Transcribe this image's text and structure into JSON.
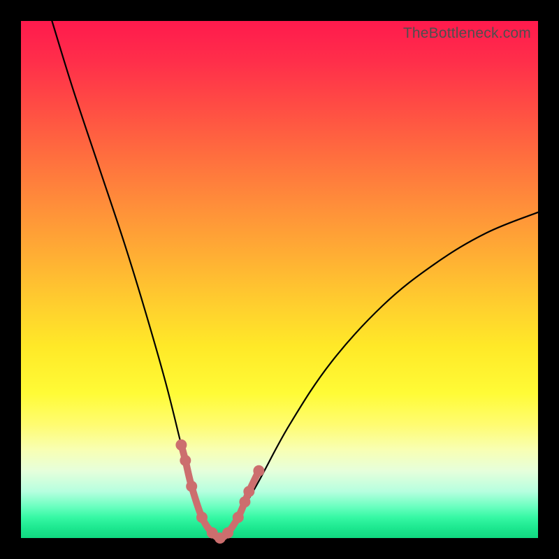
{
  "watermark": "TheBottleneck.com",
  "chart_data": {
    "type": "line",
    "title": "",
    "xlabel": "",
    "ylabel": "",
    "xlim": [
      0,
      100
    ],
    "ylim": [
      0,
      100
    ],
    "grid": false,
    "legend": false,
    "background": "rainbow-gradient",
    "series": [
      {
        "name": "bottleneck-curve",
        "x": [
          6,
          10,
          15,
          20,
          24,
          28,
          31,
          33,
          35,
          37,
          38.5,
          40,
          42,
          46,
          52,
          60,
          70,
          80,
          90,
          100
        ],
        "values": [
          100,
          87,
          72,
          57,
          44,
          30,
          18,
          10,
          4,
          1,
          0,
          1,
          4,
          11,
          22,
          34,
          45,
          53,
          59,
          63
        ]
      }
    ],
    "markers": {
      "name": "highlighted-range",
      "color": "#cc6e6e",
      "points": [
        {
          "x": 31,
          "y": 18
        },
        {
          "x": 31.8,
          "y": 15
        },
        {
          "x": 33,
          "y": 10
        },
        {
          "x": 35,
          "y": 4
        },
        {
          "x": 37,
          "y": 1
        },
        {
          "x": 38.5,
          "y": 0
        },
        {
          "x": 40,
          "y": 1
        },
        {
          "x": 42,
          "y": 4
        },
        {
          "x": 43.3,
          "y": 7
        },
        {
          "x": 44.1,
          "y": 9
        },
        {
          "x": 46,
          "y": 13
        }
      ]
    }
  }
}
